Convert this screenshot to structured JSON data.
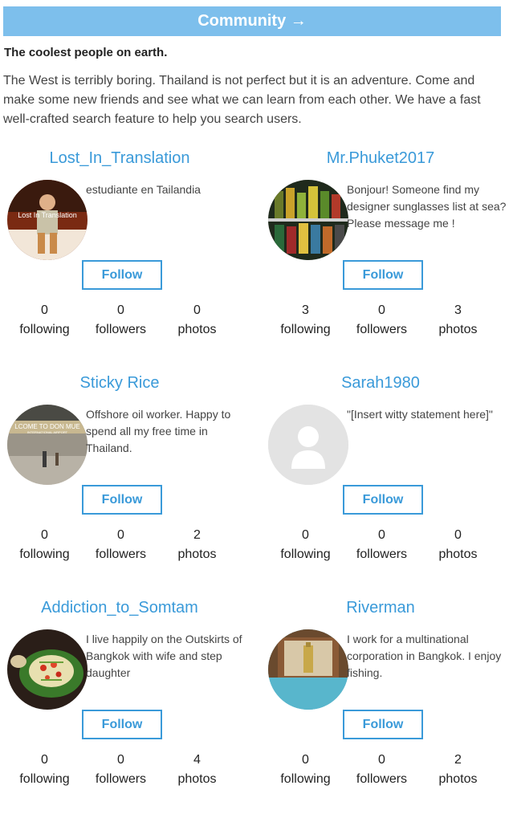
{
  "header": {
    "banner": "Community →",
    "tagline": "The coolest people on earth.",
    "intro": "The West is terribly boring. Thailand is not perfect but it is an adventure. Come and make some new friends and see what we can learn from each other. We have a fast well-crafted search feature to help you search users."
  },
  "labels": {
    "following": "following",
    "followers": "followers",
    "photos": "photos",
    "follow": "Follow"
  },
  "users": [
    {
      "name": "Lost_In_Translation",
      "bio": "estudiante en Tailandia",
      "following": "0",
      "followers": "0",
      "photos": "0",
      "avatar_text": "Lost In Translation"
    },
    {
      "name": "Mr.Phuket2017",
      "bio": "Bonjour! Someone find my designer sunglasses list at sea? Please message me !",
      "following": "3",
      "followers": "0",
      "photos": "3"
    },
    {
      "name": "Sticky Rice",
      "bio": "Offshore oil worker. Happy to spend all my free time in Thailand.",
      "following": "0",
      "followers": "0",
      "photos": "2",
      "avatar_text": "LCOME TO DON MUE",
      "avatar_subtext": "INTERNATIONAL AIRPORT"
    },
    {
      "name": "Sarah1980",
      "bio": "\"[Insert witty statement here]\"",
      "following": "0",
      "followers": "0",
      "photos": "0"
    },
    {
      "name": "Addiction_to_Somtam",
      "bio": "I live happily on the Outskirts of Bangkok with wife and step daughter",
      "following": "0",
      "followers": "0",
      "photos": "4"
    },
    {
      "name": "Riverman",
      "bio": "I work for a multinational corporation in Bangkok. I enjoy fishing.",
      "following": "0",
      "followers": "0",
      "photos": "2"
    }
  ]
}
